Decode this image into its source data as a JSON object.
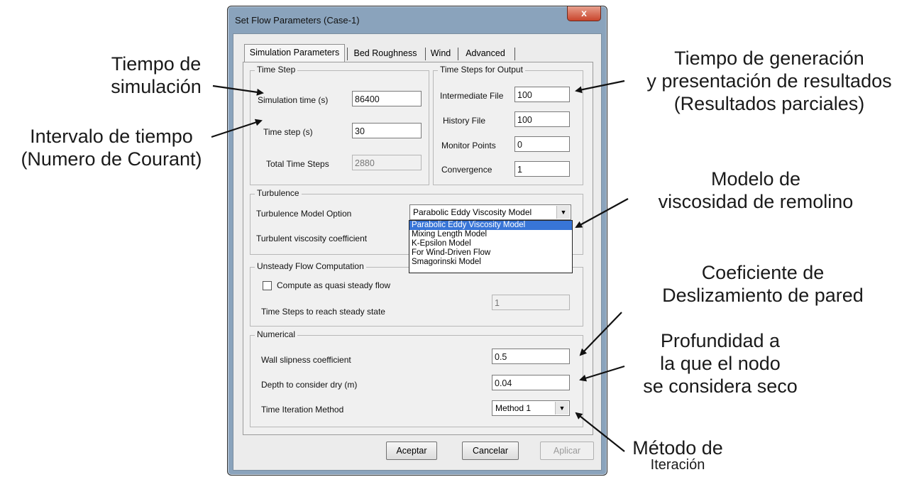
{
  "dialog": {
    "title": "Set Flow Parameters (Case-1)",
    "close_glyph": "x",
    "tabs": [
      "Simulation Parameters",
      "Bed Roughness",
      "Wind",
      "Advanced"
    ],
    "time_step": {
      "group_title": "Time Step",
      "simulation_time_label": "Simulation time (s)",
      "simulation_time_value": "86400",
      "time_step_label": "Time step (s)",
      "time_step_value": "30",
      "total_steps_label": "Total Time Steps",
      "total_steps_value": "2880"
    },
    "output": {
      "group_title": "Time Steps for Output",
      "intermediate_label": "Intermediate File",
      "intermediate_value": "100",
      "history_label": "History File",
      "history_value": "100",
      "monitor_label": "Monitor Points",
      "monitor_value": "0",
      "convergence_label": "Convergence",
      "convergence_value": "1"
    },
    "turbulence": {
      "group_title": "Turbulence",
      "model_label": "Turbulence Model Option",
      "model_selected": "Parabolic Eddy Viscosity Model",
      "coef_label": "Turbulent viscosity coefficient",
      "options": [
        "Parabolic Eddy Viscosity Model",
        "Mixing Length Model",
        "K-Epsilon Model",
        "For Wind-Driven Flow",
        "Smagorinski Model"
      ]
    },
    "unsteady": {
      "group_title": "Unsteady Flow Computation",
      "quasi_label": "Compute as quasi steady flow",
      "steps_label": "Time Steps to reach steady state",
      "steps_value": "1"
    },
    "numerical": {
      "group_title": "Numerical",
      "wall_label": "Wall slipness coefficient",
      "wall_value": "0.5",
      "depth_label": "Depth to consider dry (m)",
      "depth_value": "0.04",
      "method_label": "Time Iteration Method",
      "method_value": "Method 1"
    },
    "buttons": {
      "ok": "Aceptar",
      "cancel": "Cancelar",
      "apply": "Aplicar"
    }
  },
  "annotations": {
    "sim_time": [
      "Tiempo de",
      "simulación"
    ],
    "interval": [
      "Intervalo de tiempo",
      "(Numero de Courant)"
    ],
    "output_time": [
      "Tiempo de generación",
      "y presentación de resultados",
      "(Resultados parciales)"
    ],
    "eddy": [
      "Modelo de",
      "viscosidad de remolino"
    ],
    "wall": [
      "Coeficiente de",
      "Deslizamiento de pared"
    ],
    "depth": [
      "Profundidad a",
      "la que el nodo",
      "se considera seco"
    ],
    "method": [
      "Método de",
      "Iteración"
    ]
  }
}
